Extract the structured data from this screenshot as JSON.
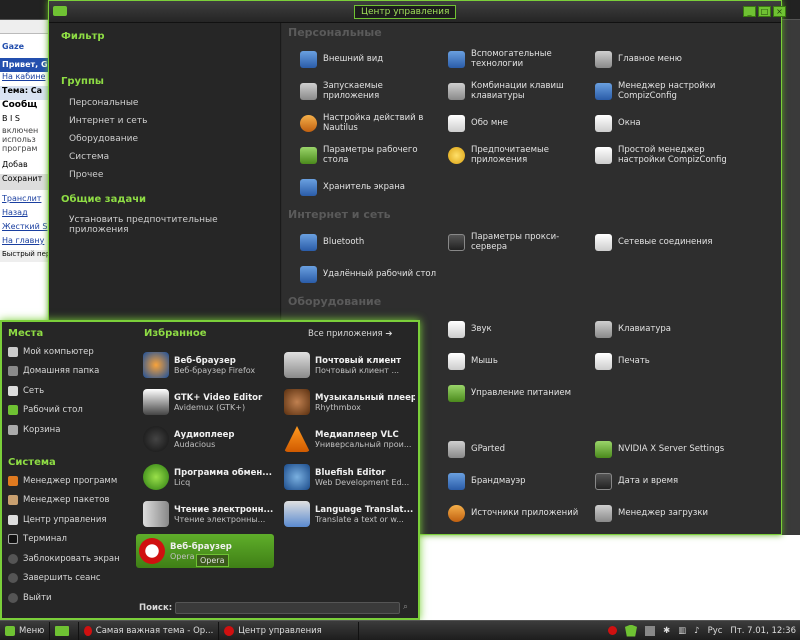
{
  "background_browser": {
    "lines": [
      "Gaze",
      "Привет, G",
      "На кабине",
      "Тема: Са",
      "Сообщ",
      "B I S",
      "включен",
      "использ",
      "програм",
      "Добав",
      "Сохранит",
      "Транслит",
      "Назад",
      "Жесткий S",
      "На главну",
      "Быстрый пер"
    ]
  },
  "control_center": {
    "title": "Центр управления",
    "sidebar": {
      "filter_label": "Фильтр",
      "groups_label": "Группы",
      "groups": [
        "Персональные",
        "Интернет и сеть",
        "Оборудование",
        "Система",
        "Прочее"
      ],
      "tasks_label": "Общие задачи",
      "tasks": [
        "Установить предпочтительные приложения"
      ]
    },
    "sections": {
      "personal": "Персональные",
      "internet": "Интернет и сеть",
      "hardware": "Оборудование"
    },
    "items": {
      "appearance": "Внешний вид",
      "assistive": "Вспомогательные\nтехнологии",
      "main_menu": "Главное меню",
      "startup": "Запускаемые\nприложения",
      "shortcuts": "Комбинации клавиш\nклавиатуры",
      "compiz": "Менеджер настройки\nCompizConfig",
      "nautilus": "Настройка действий в\nNautilus",
      "about_me": "Обо мне",
      "windows": "Окна",
      "desktop": "Параметры рабочего\nстола",
      "preferred": "Предпочитаемые\nприложения",
      "simple_compiz": "Простой менеджер\nнастройки CompizConfig",
      "screensaver": "Хранитель экрана",
      "bluetooth": "Bluetooth",
      "proxy": "Параметры прокси-\nсервера",
      "network": "Сетевые соединения",
      "remote_desktop": "Удалённый рабочий стол",
      "sound": "Звук",
      "keyboard": "Клавиатура",
      "mouse": "Мышь",
      "print": "Печать",
      "power": "Управление питанием",
      "gparted": "GParted",
      "nvidia": "NVIDIA X Server Settings",
      "firewall": "Брандмауэр",
      "datetime": "Дата и время",
      "sources": "Источники приложений",
      "download": "Менеджер загрузки"
    }
  },
  "menu": {
    "places_label": "Места",
    "places": [
      "Мой компьютер",
      "Домашняя папка",
      "Сеть",
      "Рабочий стол",
      "Корзина"
    ],
    "system_label": "Система",
    "system": [
      "Менеджер программ",
      "Менеджер пакетов",
      "Центр управления",
      "Терминал",
      "Заблокировать экран",
      "Завершить сеанс",
      "Выйти"
    ],
    "favorites_label": "Избранное",
    "all_apps": "Все приложения",
    "favorites": [
      {
        "name": "Веб-браузер",
        "desc": "Веб-браузер Firefox"
      },
      {
        "name": "Почтовый клиент",
        "desc": "Почтовый клиент ..."
      },
      {
        "name": "GTK+ Video Editor",
        "desc": "Avidemux (GTK+)"
      },
      {
        "name": "Музыкальный плеер",
        "desc": "Rhythmbox"
      },
      {
        "name": "Аудиоплеер",
        "desc": "Audacious"
      },
      {
        "name": "Медиаплеер VLC",
        "desc": "Универсальный прои..."
      },
      {
        "name": "Программа обмен...",
        "desc": "Licq"
      },
      {
        "name": "Bluefish Editor",
        "desc": "Web Development Ed..."
      },
      {
        "name": "Чтение электронн...",
        "desc": "Чтение электронны..."
      },
      {
        "name": "Language Translat...",
        "desc": "Translate a text or w..."
      },
      {
        "name": "Веб-браузер",
        "desc": "Opera"
      }
    ],
    "tooltip": "Opera",
    "search_label": "Поиск:"
  },
  "taskbar": {
    "menu_label": "Меню",
    "tasks": [
      "Самая важная тема - Op...",
      "Центр управления"
    ],
    "lang": "Рус",
    "date": "Пт. 7.01, 12:36"
  }
}
